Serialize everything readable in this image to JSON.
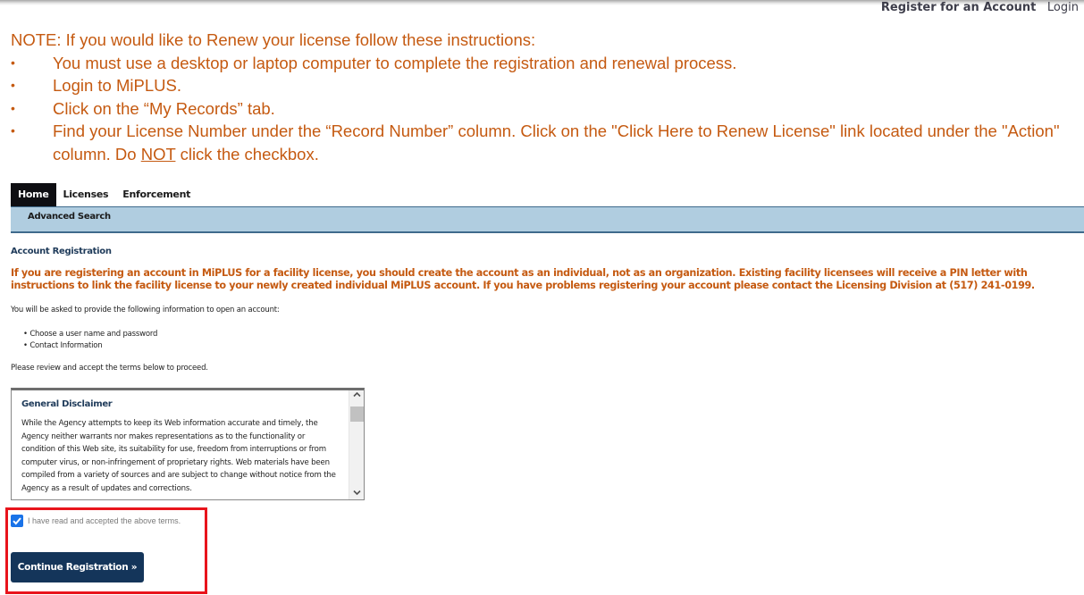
{
  "header": {
    "register_link": "Register for an Account",
    "login_link": "Login"
  },
  "note": {
    "heading": "NOTE: If you would like to Renew your license follow these instructions:",
    "items": [
      "You must use a desktop or laptop computer to complete the registration and renewal process.",
      "Login to MiPLUS.",
      "Click on the “My Records” tab."
    ],
    "last_item": {
      "before": "Find your License Number under the “Record Number” column. Click on the \"Click Here to Renew License\" link located under the \"Action\" column. Do ",
      "underlined": "NOT",
      "after": " click the checkbox."
    },
    "color": "#c55a11"
  },
  "nav": {
    "tabs": [
      {
        "label": "Home",
        "active": true
      },
      {
        "label": "Licenses",
        "active": false
      },
      {
        "label": "Enforcement",
        "active": false
      }
    ],
    "subnav": {
      "label": "Advanced Search"
    }
  },
  "main": {
    "section_title": "Account Registration",
    "facility_notice": "If you are registering an account in MiPLUS for a facility license, you should create the account as an individual, not as an organization.  Existing facility licensees will receive a PIN letter with instructions to link the facility license to your newly created individual MiPLUS account. If you have problems registering your account please contact the Licensing Division at (517) 241-0199.",
    "info_intro": "You will be asked to provide the following information to open an account:",
    "requirements": [
      "• Choose a user name and password",
      "• Contact Information"
    ],
    "review_text": "Please review and accept the terms below to proceed.",
    "disclaimer": {
      "title": "General Disclaimer",
      "body": "While the Agency attempts to keep its Web information accurate and timely, the Agency neither warrants nor makes representations as to the functionality or condition of this Web site, its suitability for use, freedom from interruptions or from computer virus, or non-infringement of proprietary rights. Web materials have been compiled from a variety of sources and are subject to change without notice from the Agency as a result of updates and corrections."
    },
    "accept_checkbox": {
      "label": "I have read and accepted the above terms.",
      "checked": true
    },
    "continue_button": "Continue Registration »"
  },
  "colors": {
    "accent_orange": "#c55a11",
    "nav_active": "#0e0e12",
    "subnav_bg": "#b0cde0",
    "button_bg": "#14355a",
    "highlight_border": "#e8141c",
    "checkbox": "#1a73e8"
  }
}
